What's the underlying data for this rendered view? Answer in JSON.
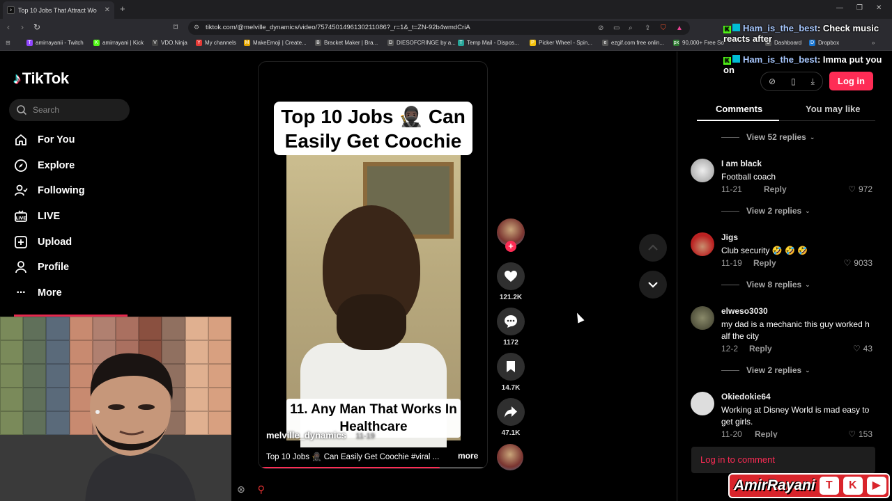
{
  "browser": {
    "tab_title": "Top 10 Jobs That Attract Wo",
    "new_tab": "+",
    "url": "tiktok.com/@melville_dynamics/video/7574501496130211086?_r=1&_t=ZN-92b4wmdCriA",
    "bookmarks": [
      {
        "label": "amirrayanii - Twitch",
        "icon": "T",
        "color": "#9146ff"
      },
      {
        "label": "amirrayani | Kick",
        "icon": "K",
        "color": "#53fc18"
      },
      {
        "label": "VDO.Ninja",
        "icon": "V",
        "color": "#444"
      },
      {
        "label": "My channels",
        "icon": "Y",
        "color": "#e53935"
      },
      {
        "label": "MakeEmoji | Create...",
        "icon": "M",
        "color": "#e6a700"
      },
      {
        "label": "Bracket Maker | Bra...",
        "icon": "B",
        "color": "#555"
      },
      {
        "label": "DIESOFCRINGE by a...",
        "icon": "D",
        "color": "#555"
      },
      {
        "label": "Temp Mail - Dispos...",
        "icon": "T",
        "color": "#26a69a"
      },
      {
        "label": "Picker Wheel - Spin...",
        "icon": "P",
        "color": "#f4c20d"
      },
      {
        "label": "ezgif.com free onlin...",
        "icon": "e",
        "color": "#555"
      },
      {
        "label": "90,000+ Free So",
        "icon": "px",
        "color": "#2e7d32"
      },
      {
        "label": "Dashboard",
        "icon": "D",
        "color": "#555"
      },
      {
        "label": "Dropbox",
        "icon": "D",
        "color": "#1976d2"
      }
    ]
  },
  "sidebar": {
    "logo": "TikTok",
    "search_placeholder": "Search",
    "items": [
      {
        "label": "For You",
        "icon": "home-icon"
      },
      {
        "label": "Explore",
        "icon": "compass-icon"
      },
      {
        "label": "Following",
        "icon": "following-icon"
      },
      {
        "label": "LIVE",
        "icon": "live-icon"
      },
      {
        "label": "Upload",
        "icon": "upload-icon"
      },
      {
        "label": "Profile",
        "icon": "profile-icon"
      },
      {
        "label": "More",
        "icon": "more-icon"
      }
    ]
  },
  "video": {
    "caption_top": "Top 10 Jobs 🥷🏿 Can Easily Get Coochie",
    "caption_bottom": "11. Any Man That Works In Healthcare",
    "author": "melville_dynamics",
    "author_meta": "11-19",
    "description": "Top 10 Jobs 🥷🏿 Can Easily Get Coochie #viral ...",
    "more_label": "more",
    "progress": 0.8
  },
  "actions": {
    "likes": "121.2K",
    "comments": "1172",
    "saves": "14.7K",
    "shares": "47.1K"
  },
  "panel": {
    "login_label": "Log in",
    "tab_comments": "Comments",
    "tab_you_may_like": "You may like",
    "login_comment": "Log in to comment",
    "reply_label": "Reply",
    "view_replies": [
      "View 52 replies",
      "View 2 replies",
      "View 8 replies",
      "View 2 replies"
    ],
    "comments": [
      {
        "user": "I am black",
        "text": "Football coach",
        "date": "11-21",
        "likes": "972"
      },
      {
        "user": "Jigs",
        "text": "Club security 🤣 🤣 🤣",
        "date": "11-19",
        "likes": "9033"
      },
      {
        "user": "elweso3030",
        "text": "my dad is a mechanic this guy worked h alf the city",
        "date": "12-2",
        "likes": "43"
      },
      {
        "user": "Okiedokie64",
        "text": "Working at Disney World is mad easy to get girls.",
        "date": "11-20",
        "likes": "153"
      }
    ]
  },
  "stream_overlay": {
    "chat": [
      {
        "user": "Ham_is_the_best",
        "message": ": Check music reacts after"
      },
      {
        "user": "Ham_is_the_best",
        "message": ": Imma put you on"
      }
    ],
    "brand": "AmirRayani",
    "brand_icons": [
      "T",
      "K",
      "▶"
    ]
  },
  "colors": {
    "accent": "#fe2c55",
    "kick": "#53fc18",
    "twitch": "#9146ff"
  }
}
